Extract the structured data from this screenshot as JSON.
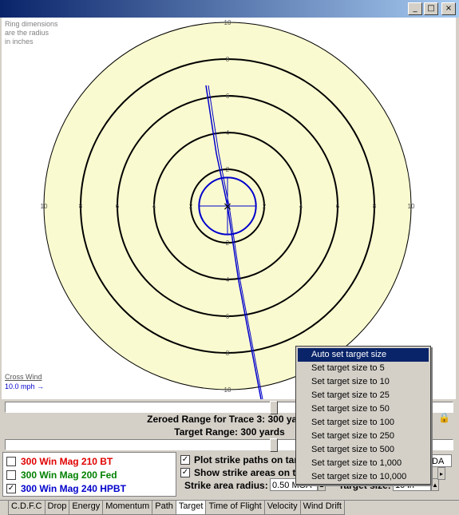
{
  "window": {
    "title": "",
    "minimize": "_",
    "maximize": "□",
    "close": "×"
  },
  "target": {
    "note": "Ring dimensions\nare the radius\nin inches",
    "ring_labels": [
      "10",
      "8",
      "6",
      "4",
      "2"
    ],
    "ring_color": "#000000",
    "face_color": "#fafad0",
    "path_color": "#0000cc",
    "strike_color": "#0000cc"
  },
  "wind": {
    "label": "Cross Wind",
    "value": "10.0 mph →"
  },
  "info": {
    "zeroed_range": "Zeroed Range for Trace 3:  300 yards",
    "target_range": "Target Range:  300 yards"
  },
  "traces": [
    {
      "label": "300 Win Mag 210 BT",
      "checked": false,
      "color": "#e00000"
    },
    {
      "label": "300 Win Mag 200 Fed",
      "checked": false,
      "color": "#008000"
    },
    {
      "label": "300 Win Mag 240 HPBT",
      "checked": true,
      "color": "#0000cc"
    }
  ],
  "options": {
    "plot_strike": "Plot strike paths on target",
    "show_strike": "Show strike areas on target",
    "strike_radius_label": "Strike area radius:",
    "strike_radius_value": "0.50 MOA",
    "target_size_label": "Target size:",
    "target_size_value": "10 in",
    "right_field_value": "DA"
  },
  "tabs": [
    {
      "label": "C.D.F.C",
      "active": false
    },
    {
      "label": "Drop",
      "active": false
    },
    {
      "label": "Energy",
      "active": false
    },
    {
      "label": "Momentum",
      "active": false
    },
    {
      "label": "Path",
      "active": false
    },
    {
      "label": "Target",
      "active": true
    },
    {
      "label": "Time of Flight",
      "active": false
    },
    {
      "label": "Velocity",
      "active": false
    },
    {
      "label": "Wind Drift",
      "active": false
    }
  ],
  "context_menu": {
    "items": [
      "Auto set target size",
      "Set target size to 5",
      "Set target size to 10",
      "Set target size to 25",
      "Set target size to 50",
      "Set target size to 100",
      "Set target size to 250",
      "Set target size to 500",
      "Set target size to 1,000",
      "Set target size to 10,000"
    ],
    "highlighted_index": 0
  }
}
